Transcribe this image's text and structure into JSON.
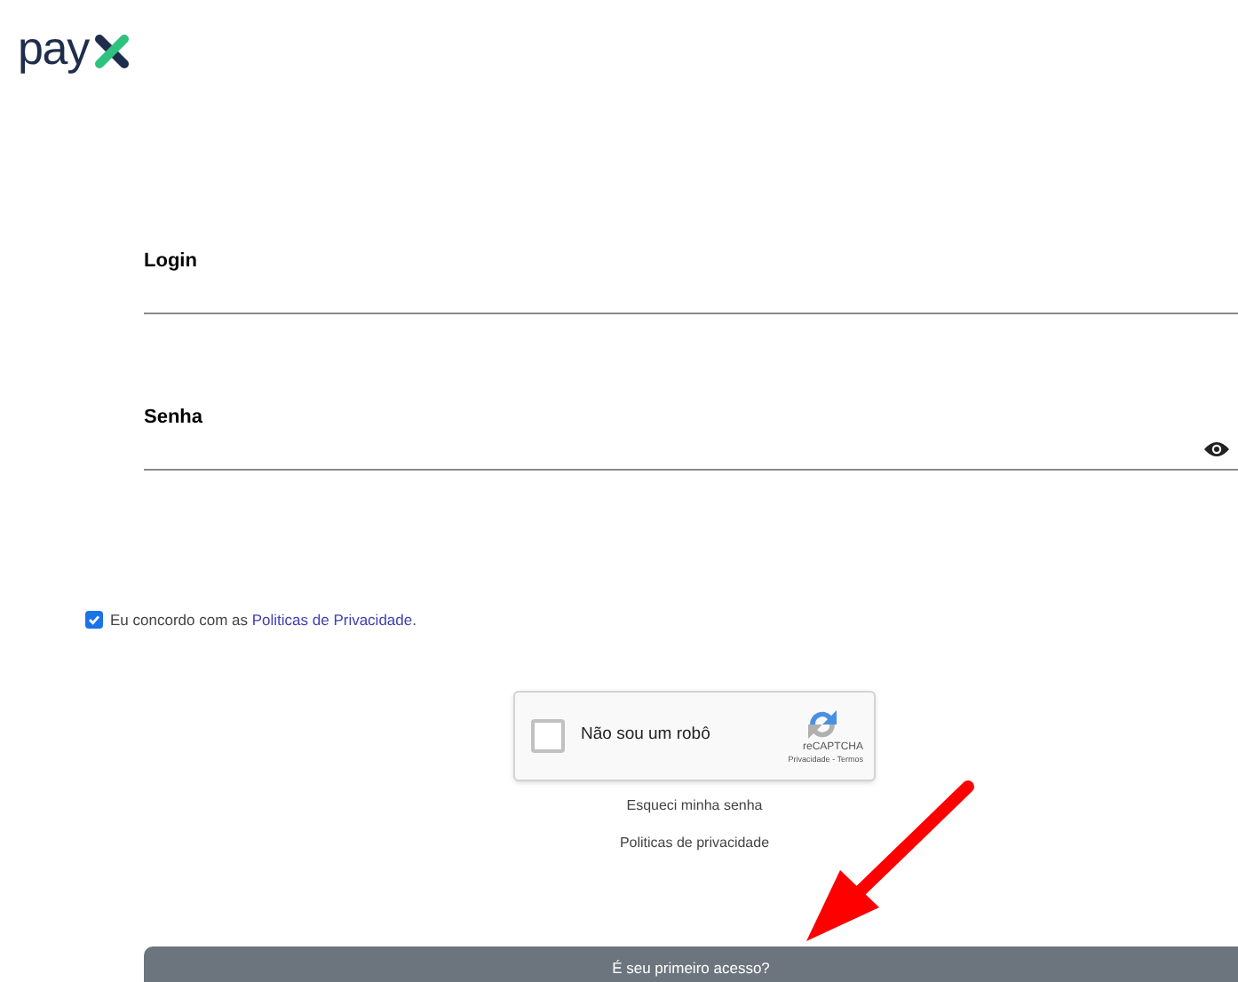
{
  "logo": {
    "text": "pay"
  },
  "fields": [
    {
      "label": "Login",
      "kind": "text"
    },
    {
      "label": "Senha",
      "kind": "password"
    }
  ],
  "consent": {
    "checked": true,
    "text": "Eu concordo com as ",
    "link": "Politicas de Privacidade",
    "after": "."
  },
  "captcha": {
    "label": "Não sou um robô",
    "checked": false,
    "brand": "reCAPTCHA",
    "privacy": "Privacidade",
    "separator": " - ",
    "terms": "Termos"
  },
  "links": [
    "Esqueci minha senha",
    "Politicas de privacidade"
  ],
  "first_access_button": "É seu primeiro acesso?"
}
